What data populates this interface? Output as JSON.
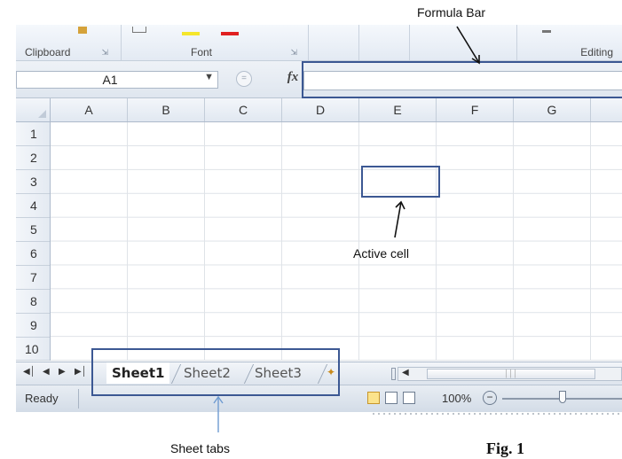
{
  "ribbon": {
    "groups": [
      "Clipboard",
      "Font",
      "Editing"
    ]
  },
  "formula_bar": {
    "name_box_value": "A1",
    "fx_label": "fx",
    "cancel_symbol": "="
  },
  "grid": {
    "columns": [
      "A",
      "B",
      "C",
      "D",
      "E",
      "F",
      "G"
    ],
    "rows": [
      "1",
      "2",
      "3",
      "4",
      "5",
      "6",
      "7",
      "8",
      "9",
      "10"
    ]
  },
  "sheet_tabs": [
    "Sheet1",
    "Sheet2",
    "Sheet3"
  ],
  "status_bar": {
    "ready": "Ready",
    "zoom": "100%"
  },
  "annotations": {
    "formula_bar_label": "Formula Bar",
    "active_cell_label": "Active cell",
    "sheet_tabs_label": "Sheet tabs",
    "figure_label": "Fig. 1"
  },
  "colors": {
    "callout": "#3c5893",
    "sheet_tabs_arrow": "#6f9bd1"
  }
}
